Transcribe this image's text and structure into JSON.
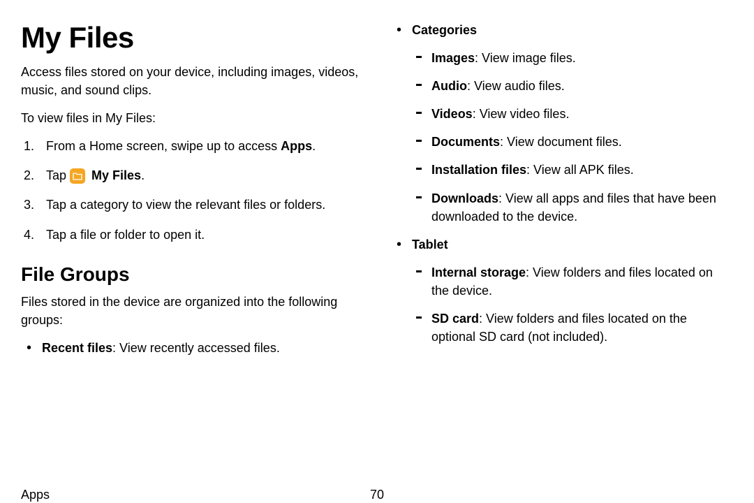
{
  "title": "My Files",
  "intro": "Access files stored on your device, including images, videos, music, and sound clips.",
  "viewPrompt": "To view files in My Files:",
  "steps": {
    "s1_a": "From a Home screen, swipe up to access ",
    "s1_b": "Apps",
    "s1_c": ".",
    "s2_a": "Tap ",
    "s2_b": "My Files",
    "s2_c": ".",
    "s3": "Tap a category to view the relevant files or folders.",
    "s4": "Tap a file or folder to open it."
  },
  "h2": "File Groups",
  "fgIntro": "Files stored in the device are organized into the following groups:",
  "recent_b": "Recent files",
  "recent_t": ": View recently accessed files.",
  "cat_label": "Categories",
  "cats": {
    "images_b": "Images",
    "images_t": ": View image files.",
    "audio_b": "Audio",
    "audio_t": ": View audio files.",
    "videos_b": "Videos",
    "videos_t": ": View video files.",
    "docs_b": "Documents",
    "docs_t": ": View document files.",
    "inst_b": "Installation files",
    "inst_t": ": View all APK files.",
    "dl_b": "Downloads",
    "dl_t": ": View all apps and files that have been downloaded to the device."
  },
  "tablet_label": "Tablet",
  "tab": {
    "int_b": "Internal storage",
    "int_t": ": View folders and files located on the device.",
    "sd_b": "SD card",
    "sd_t": ": View folders and files located on the optional SD card (not included)."
  },
  "footer": {
    "section": "Apps",
    "page": "70"
  }
}
